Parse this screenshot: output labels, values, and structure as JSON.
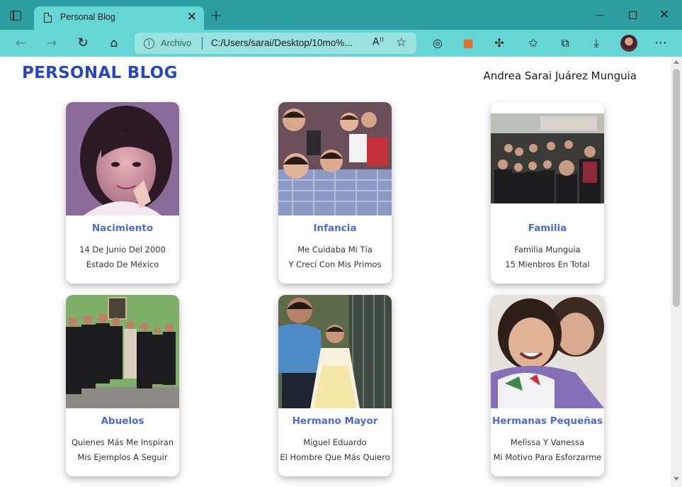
{
  "browser": {
    "tab_title": "Personal Blog",
    "url_scheme_label": "Archivo",
    "url": "C:/Users/sarai/Desktop/10mo%..."
  },
  "blog": {
    "title": "PERSONAL BLOG",
    "author": "Andrea Sarai Juárez Munguia"
  },
  "cards": [
    {
      "title": "Nacimiento",
      "line1": "14 De Junio Del 2000",
      "line2": "Estado De México"
    },
    {
      "title": "Infancia",
      "line1": "Me Cuidaba Mi Tía",
      "line2": "Y Crecí Con Mis Primos"
    },
    {
      "title": "Familia",
      "line1": "Familia Munguia",
      "line2": "15 Mienbros En Total"
    },
    {
      "title": "Abuelos",
      "line1": "Quienes Más Me Inspiran",
      "line2": "Mis Ejemplos A Seguir"
    },
    {
      "title": "Hermano Mayor",
      "line1": "Miguel Eduardo",
      "line2": "El Hombre Que Más Quiero"
    },
    {
      "title": "Hermanas Pequeñas",
      "line1": "Melissa Y Vanessa",
      "line2": "Mi Motivo Para Esforzarme"
    }
  ],
  "colors": {
    "frame": "#2d9fa1",
    "toolbar": "#66d6d4",
    "blog_title": "#2547c4",
    "card_title": "#4a6ad8"
  }
}
